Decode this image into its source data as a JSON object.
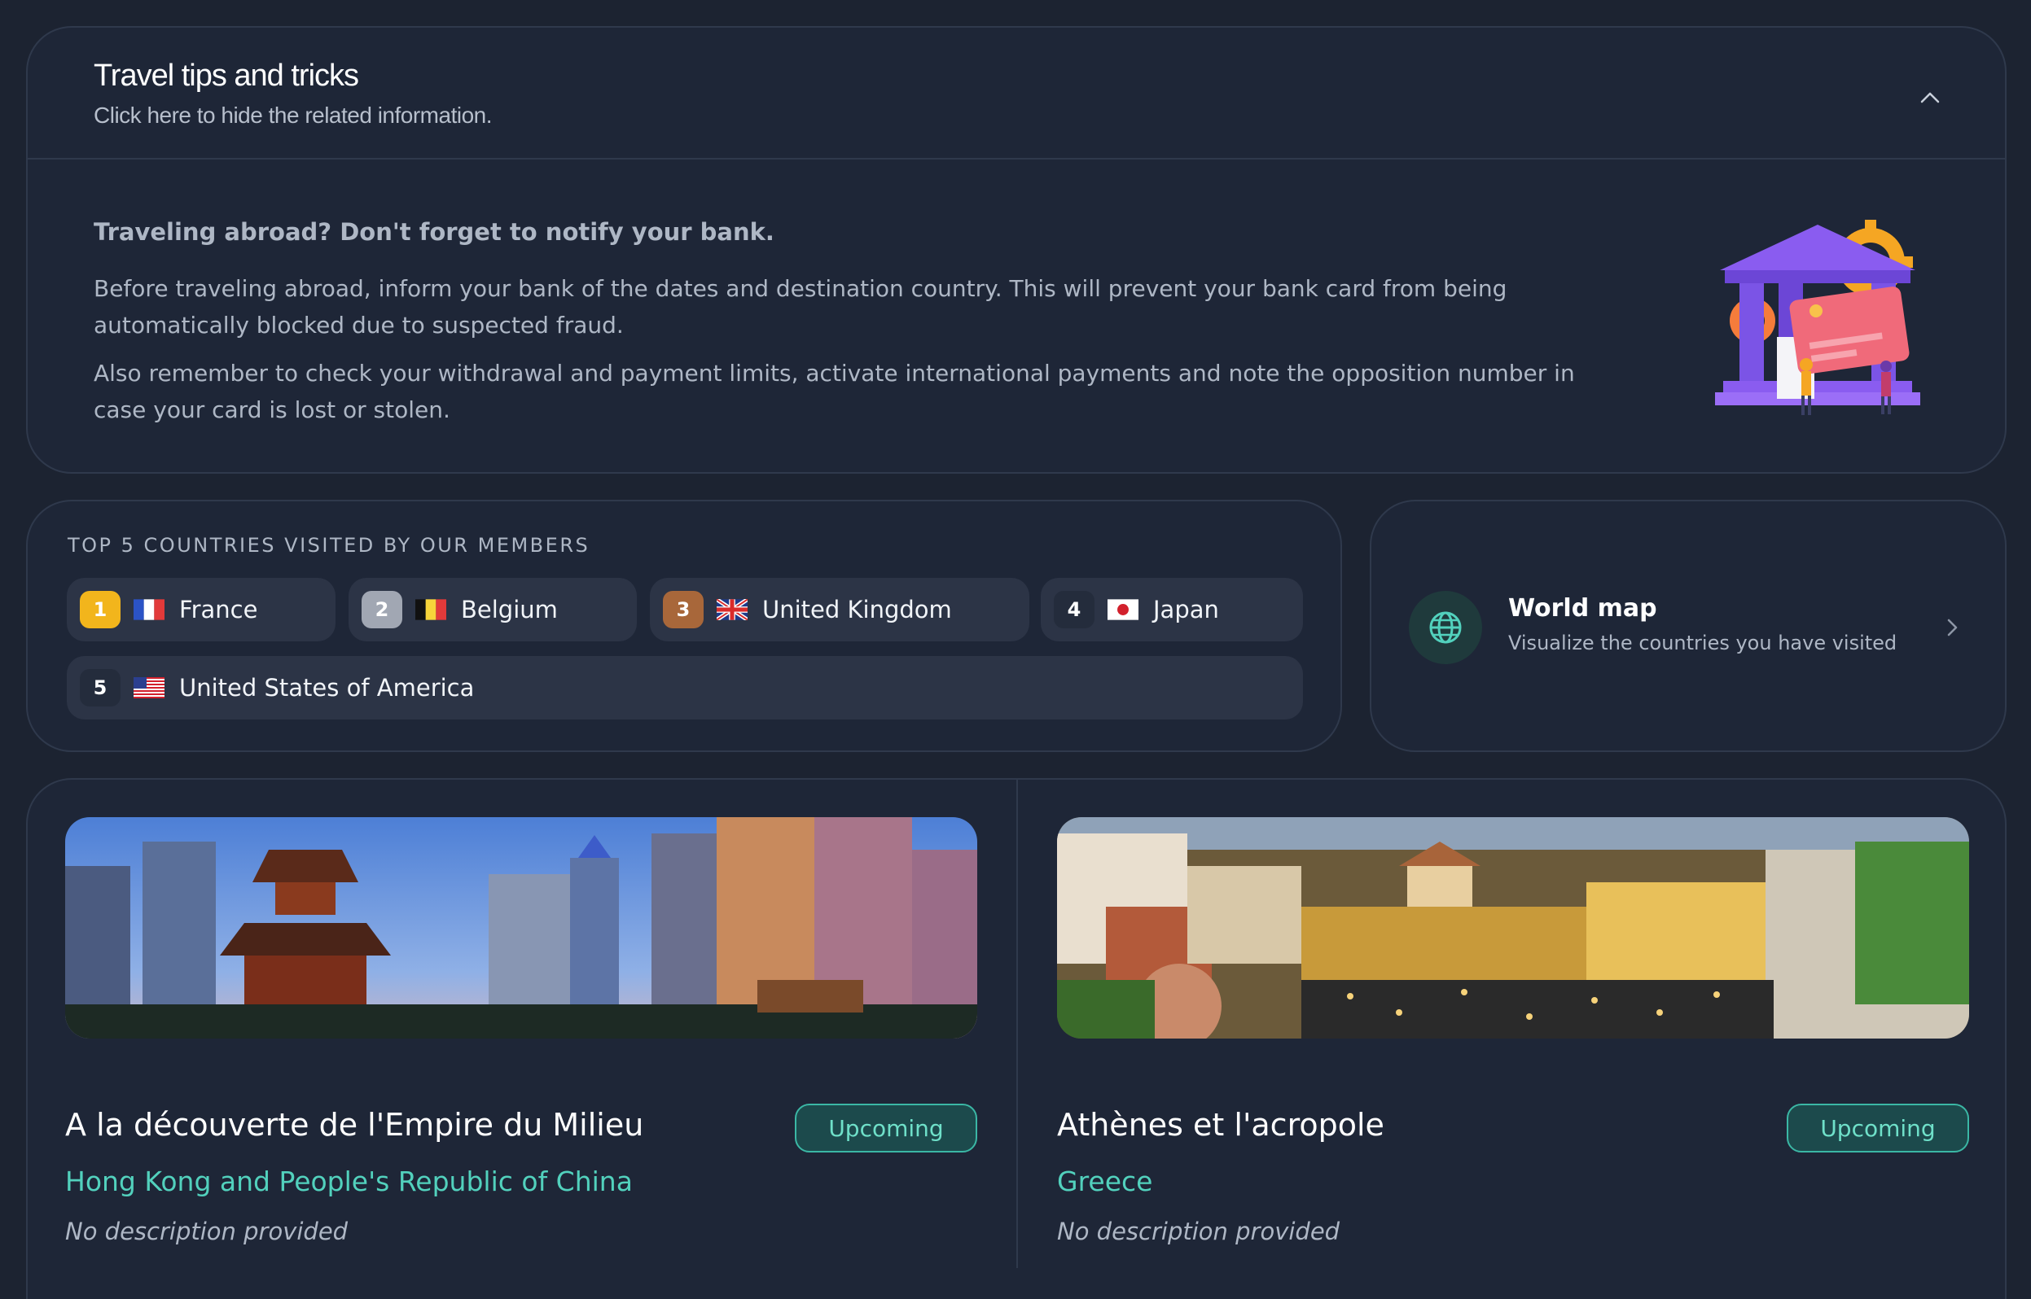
{
  "tips": {
    "title": "Travel tips and tricks",
    "subtitle": "Click here to hide the related information.",
    "heading": "Traveling abroad? Don't forget to notify your bank.",
    "paragraph1": "Before traveling abroad, inform your bank of the dates and destination country. This will prevent your bank card from being automatically blocked due to suspected fraud.",
    "paragraph2": "Also remember to check your withdrawal and payment limits, activate international payments and note the opposition number in case your card is lost or stolen."
  },
  "top_countries": {
    "label": "TOP 5 COUNTRIES VISITED BY OUR MEMBERS",
    "items": [
      {
        "rank": "1",
        "name": "France",
        "rank_color": "#f2b51c",
        "flag": "france-flag"
      },
      {
        "rank": "2",
        "name": "Belgium",
        "rank_color": "#a1a7b3",
        "flag": "belgium-flag"
      },
      {
        "rank": "3",
        "name": "United Kingdom",
        "rank_color": "#a8673a",
        "flag": "uk-flag"
      },
      {
        "rank": "4",
        "name": "Japan",
        "rank_color": "#242c3c",
        "flag": "japan-flag"
      },
      {
        "rank": "5",
        "name": "United States of America",
        "rank_color": "#242c3c",
        "flag": "usa-flag"
      }
    ]
  },
  "world_map": {
    "title": "World map",
    "subtitle": "Visualize the countries you have visited",
    "icon": "globe-icon"
  },
  "trips": [
    {
      "title": "A la découverte de l'Empire du Milieu",
      "status": "Upcoming",
      "location": "Hong Kong and People's Republic of China",
      "description": "No description provided"
    },
    {
      "title": "Athènes et l'acropole",
      "status": "Upcoming",
      "location": "Greece",
      "description": "No description provided"
    }
  ],
  "colors": {
    "background": "#1c2331",
    "card": "#1e2637",
    "accent": "#52d1bd",
    "badge_bg": "#1c4a4c"
  }
}
